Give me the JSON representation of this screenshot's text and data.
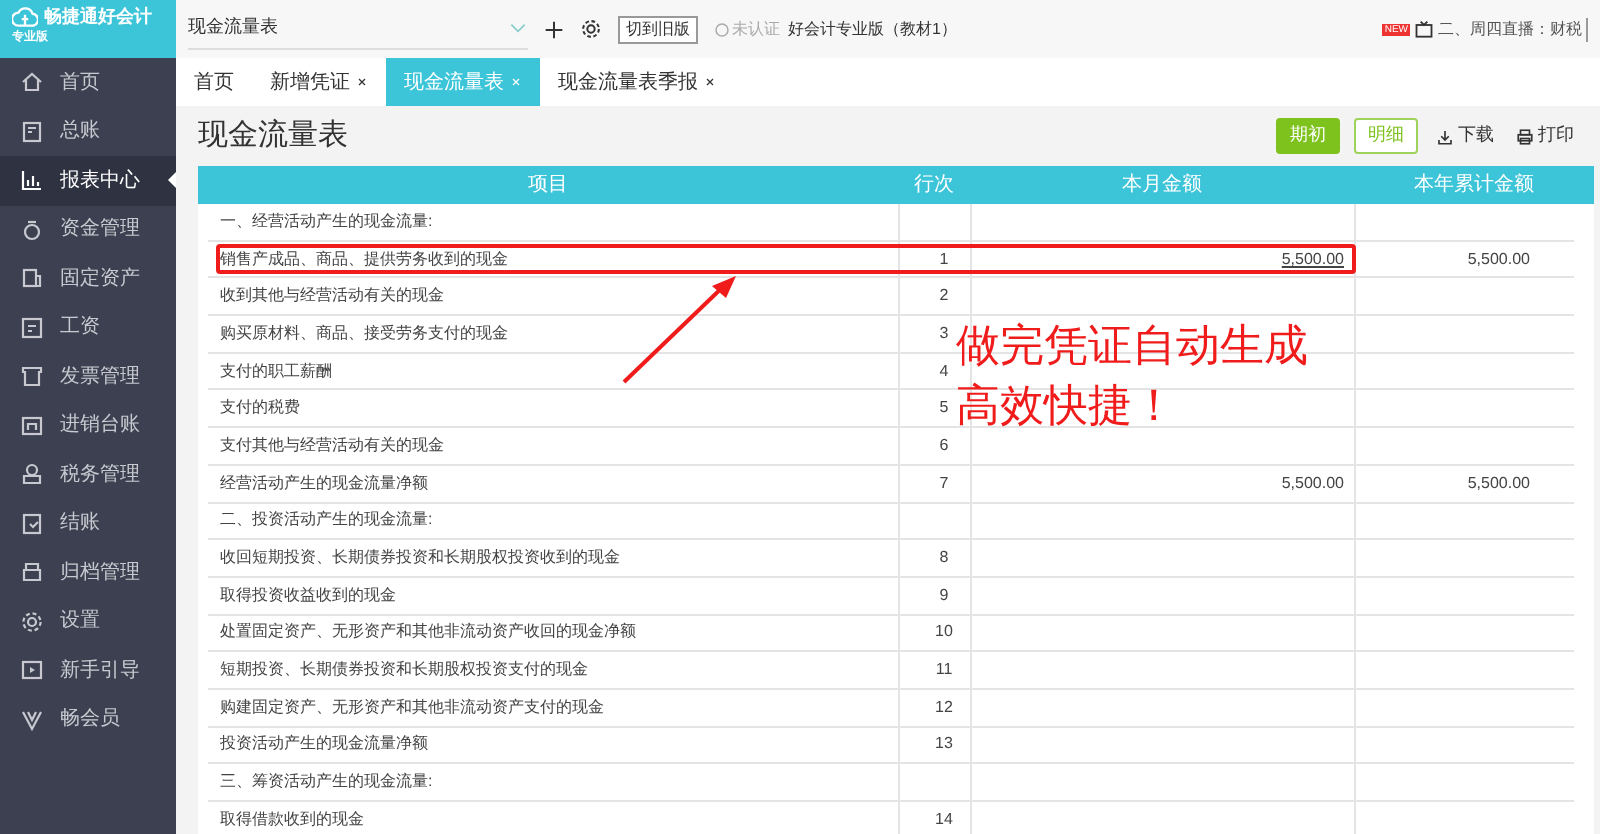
{
  "logo": {
    "name": "畅捷通好会计",
    "edition": "专业版"
  },
  "sidebar": {
    "items": [
      {
        "label": "首页",
        "selected": false
      },
      {
        "label": "总账",
        "selected": false
      },
      {
        "label": "报表中心",
        "selected": true
      },
      {
        "label": "资金管理",
        "selected": false
      },
      {
        "label": "固定资产",
        "selected": false
      },
      {
        "label": "工资",
        "selected": false
      },
      {
        "label": "发票管理",
        "selected": false
      },
      {
        "label": "进销台账",
        "selected": false
      },
      {
        "label": "税务管理",
        "selected": false
      },
      {
        "label": "结账",
        "selected": false
      },
      {
        "label": "归档管理",
        "selected": false
      },
      {
        "label": "设置",
        "selected": false
      },
      {
        "label": "新手引导",
        "selected": false
      },
      {
        "label": "畅会员",
        "selected": false
      }
    ]
  },
  "topbar": {
    "search_value": "现金流量表",
    "old_version_button": "切到旧版",
    "verify_status": "未认证",
    "company": "好会计专业版（教材1）",
    "news_badge": "NEW",
    "news_text": "二、周四直播：财税"
  },
  "tabs": [
    {
      "label": "首页",
      "closable": false,
      "selected": false
    },
    {
      "label": "新增凭证",
      "closable": true,
      "selected": false
    },
    {
      "label": "现金流量表",
      "closable": true,
      "selected": true
    },
    {
      "label": "现金流量表季报",
      "closable": true,
      "selected": false
    }
  ],
  "page_title": "现金流量表",
  "toolbar": [
    {
      "label": "期初",
      "kind": "primary"
    },
    {
      "label": "明细",
      "kind": "outline"
    },
    {
      "label": "下载",
      "kind": "download"
    },
    {
      "label": "打印",
      "kind": "print"
    }
  ],
  "table": {
    "columns": [
      "项目",
      "行次",
      "本月金额",
      "本年累计金额"
    ],
    "rows": [
      {
        "item": "一、经营活动产生的现金流量:",
        "line": "",
        "month": "",
        "year": "",
        "highlighted": false
      },
      {
        "item": "销售产成品、商品、提供劳务收到的现金",
        "line": "1",
        "month": "5,500.00",
        "year": "5,500.00",
        "highlighted": true
      },
      {
        "item": "收到其他与经营活动有关的现金",
        "line": "2",
        "month": "",
        "year": "",
        "highlighted": false
      },
      {
        "item": "购买原材料、商品、接受劳务支付的现金",
        "line": "3",
        "month": "",
        "year": "",
        "highlighted": false
      },
      {
        "item": "支付的职工薪酬",
        "line": "4",
        "month": "",
        "year": "",
        "highlighted": false
      },
      {
        "item": "支付的税费",
        "line": "5",
        "month": "",
        "year": "",
        "highlighted": false
      },
      {
        "item": "支付其他与经营活动有关的现金",
        "line": "6",
        "month": "",
        "year": "",
        "highlighted": false
      },
      {
        "item": "经营活动产生的现金流量净额",
        "line": "7",
        "month": "5,500.00",
        "year": "5,500.00",
        "highlighted": false
      },
      {
        "item": "二、投资活动产生的现金流量:",
        "line": "",
        "month": "",
        "year": "",
        "highlighted": false
      },
      {
        "item": "收回短期投资、长期债券投资和长期股权投资收到的现金",
        "line": "8",
        "month": "",
        "year": "",
        "highlighted": false
      },
      {
        "item": "取得投资收益收到的现金",
        "line": "9",
        "month": "",
        "year": "",
        "highlighted": false
      },
      {
        "item": "处置固定资产、无形资产和其他非流动资产收回的现金净额",
        "line": "10",
        "month": "",
        "year": "",
        "highlighted": false
      },
      {
        "item": "短期投资、长期债券投资和长期股权投资支付的现金",
        "line": "11",
        "month": "",
        "year": "",
        "highlighted": false
      },
      {
        "item": "购建固定资产、无形资产和其他非流动资产支付的现金",
        "line": "12",
        "month": "",
        "year": "",
        "highlighted": false
      },
      {
        "item": "投资活动产生的现金流量净额",
        "line": "13",
        "month": "",
        "year": "",
        "highlighted": false
      },
      {
        "item": "三、筹资活动产生的现金流量:",
        "line": "",
        "month": "",
        "year": "",
        "highlighted": false
      },
      {
        "item": "取得借款收到的现金",
        "line": "14",
        "month": "",
        "year": "",
        "highlighted": false
      }
    ]
  },
  "annotation": {
    "lines": [
      "做完凭证自动生成",
      "高效快捷！"
    ]
  }
}
